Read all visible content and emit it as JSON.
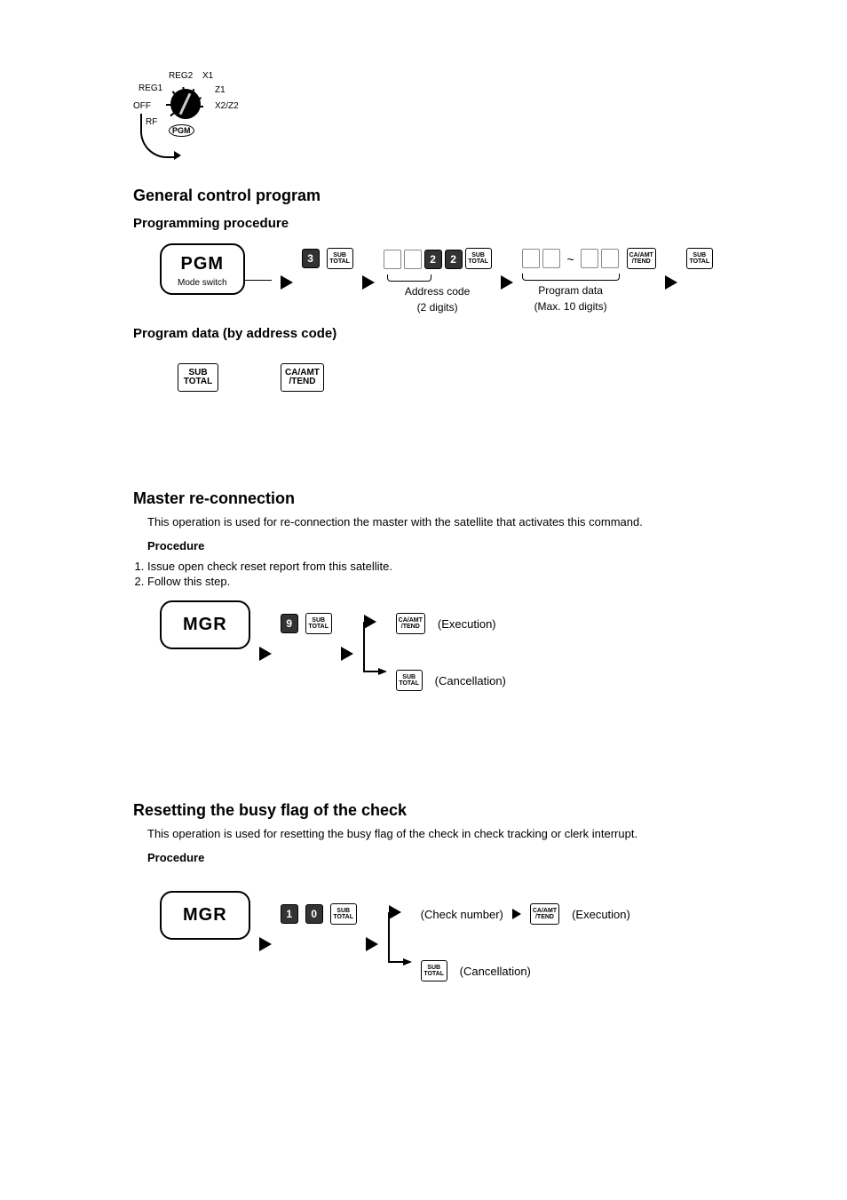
{
  "mode_dial": {
    "positions": [
      "REG2",
      "X1",
      "REG1",
      "Z1",
      "OFF",
      "X2/Z2",
      "RF"
    ],
    "selected": "PGM"
  },
  "section1": {
    "title": "General control program",
    "subtitle": "Programming procedure",
    "mode_box": "PGM",
    "mode_box_sub": "Mode switch",
    "seq_digit": "3",
    "key_subtotal_t": "SUB",
    "key_subtotal_b": "TOTAL",
    "fixed_digits": [
      "2",
      "2"
    ],
    "addr_label": "Address code",
    "addr_sub": "(2 digits)",
    "prog_label": "Program data",
    "prog_sub": "(Max. 10 digits)",
    "key_caamt_t": "CA/AMT",
    "key_caamt_b": "/TEND",
    "subtitle2": "Program data (by address code)"
  },
  "section2": {
    "title": "Master re-connection",
    "desc": "This operation is used for re-connection the master with the satellite that activates this command.",
    "proc_heading": "Procedure",
    "steps": [
      "Issue open check reset report from this satellite.",
      "Follow this step."
    ],
    "mode_box": "MGR",
    "digit": "9",
    "exec_label": "(Execution)",
    "cancel_label": "(Cancellation)"
  },
  "section3": {
    "title": "Resetting the busy flag of the check",
    "desc": "This operation is used for resetting the busy flag of the check in check tracking or clerk interrupt.",
    "proc_heading": "Procedure",
    "mode_box": "MGR",
    "digits": [
      "1",
      "0"
    ],
    "check_label": "(Check number)",
    "exec_label": "(Execution)",
    "cancel_label": "(Cancellation)"
  }
}
